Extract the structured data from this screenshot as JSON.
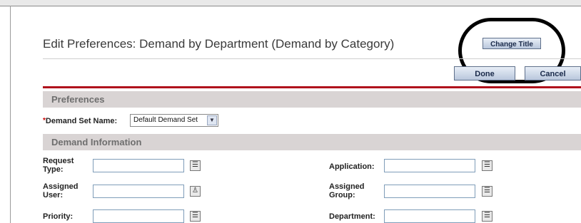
{
  "page": {
    "title": "Edit Preferences: Demand by Department (Demand by Category)",
    "change_title_label": "Change Title",
    "done_label": "Done",
    "cancel_label": "Cancel"
  },
  "preferences": {
    "section_title": "Preferences",
    "demand_set_label": "Demand Set Name:",
    "demand_set_value": "Default Demand Set"
  },
  "demand_info": {
    "section_title": "Demand Information",
    "request_type_label": "Request Type:",
    "assigned_user_label": "Assigned User:",
    "priority_label": "Priority:",
    "application_label": "Application:",
    "assigned_group_label": "Assigned Group:",
    "department_label": "Department:"
  },
  "colors": {
    "accent_red": "#b0121c",
    "section_bg": "#d9d4d4",
    "button_text": "#1a2a4a"
  },
  "icons": {
    "list_picker": "list-icon",
    "user_picker": "user-icon",
    "dropdown": "chevron-down-icon"
  }
}
